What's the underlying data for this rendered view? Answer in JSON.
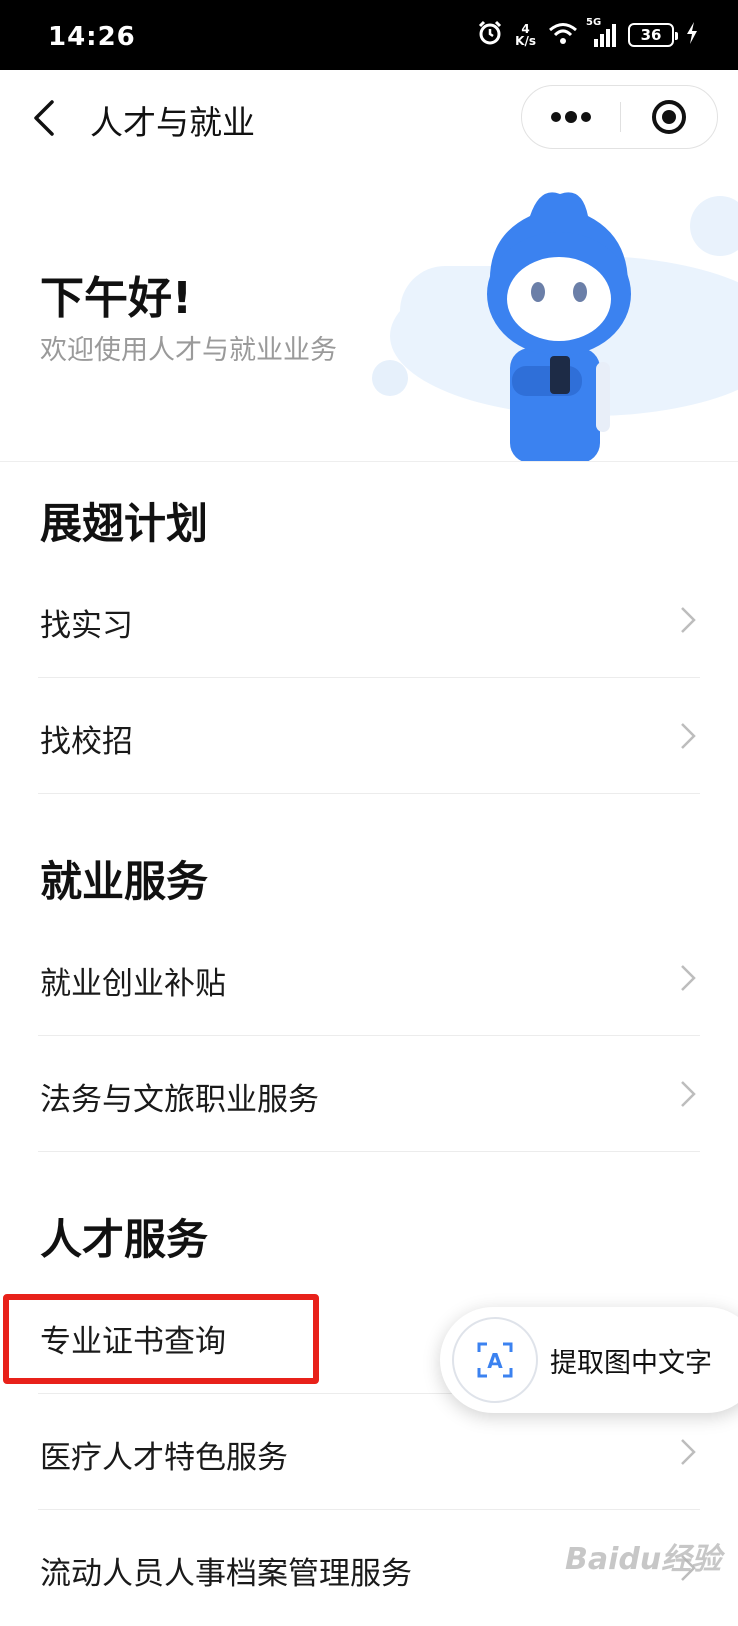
{
  "status_bar": {
    "time": "14:26",
    "speed_value": "4",
    "speed_unit": "K/s",
    "network": "5G",
    "battery": "36"
  },
  "nav": {
    "title": "人才与就业",
    "icons": [
      "back-chevron",
      "more-dots",
      "close-target"
    ]
  },
  "hero": {
    "greeting": "下午好!",
    "subtitle": "欢迎使用人才与就业业务"
  },
  "sections": [
    {
      "title": "展翅计划",
      "items": [
        {
          "label": "找实习"
        },
        {
          "label": "找校招"
        }
      ]
    },
    {
      "title": "就业服务",
      "items": [
        {
          "label": "就业创业补贴"
        },
        {
          "label": "法务与文旅职业服务"
        }
      ]
    },
    {
      "title": "人才服务",
      "items": [
        {
          "label": "专业证书查询"
        },
        {
          "label": "医疗人才特色服务"
        },
        {
          "label": "流动人员人事档案管理服务"
        }
      ]
    }
  ],
  "float_button": {
    "label": "提取图中文字",
    "icon_letter": "A"
  },
  "watermark": "Baidu经验",
  "colors": {
    "highlight": "#e8211a",
    "mascot_blue": "#3b82f0",
    "hero_bg_blob": "#e8f2fd"
  }
}
